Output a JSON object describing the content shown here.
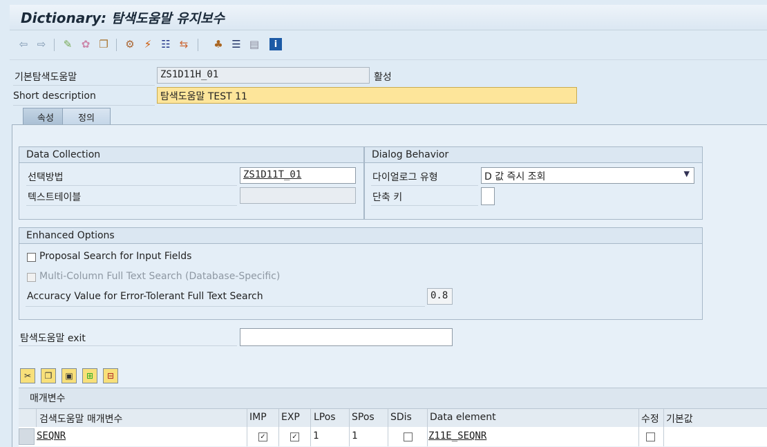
{
  "window": {
    "title": "Dictionary:",
    "title_sub": "탐색도움말 유지보수"
  },
  "toolbar": {
    "icons": [
      "back-arrow-icon",
      "forward-arrow-icon",
      "display-change-icon",
      "activate-icon",
      "other-object-icon",
      "check-icon",
      "where-used-icon",
      "object-list-icon",
      "navigate-icon",
      "hierarchy-icon",
      "documentation-icon",
      "info-icon"
    ]
  },
  "header": {
    "search_help_label": "기본탐색도움말",
    "search_help_value": "ZS1D11H_01",
    "status": "활성",
    "short_desc_label": "Short description",
    "short_desc_value": "탐색도움말 TEST 11"
  },
  "tabs": [
    "속성",
    "정의"
  ],
  "data_collection": {
    "title": "Data Collection",
    "selection_method_label": "선택방법",
    "selection_method_value": "ZS1D11T_01",
    "text_table_label": "텍스트테이블",
    "text_table_value": ""
  },
  "dialog_behavior": {
    "title": "Dialog Behavior",
    "dialog_type_label": "다이얼로그 유형",
    "dialog_type_value": "D 값 즉시 조회",
    "hotkey_label": "단축 키",
    "hotkey_value": ""
  },
  "enhanced": {
    "title": "Enhanced Options",
    "proposal_label": "Proposal Search for Input Fields",
    "multicolumn_label": "Multi-Column Full Text Search (Database-Specific)",
    "accuracy_label": "Accuracy Value for Error-Tolerant Full Text Search",
    "accuracy_value": "0.8"
  },
  "exit": {
    "label": "탐색도움말 exit",
    "value": ""
  },
  "params": {
    "section_label": "매개변수",
    "columns": [
      "검색도움말 매개변수",
      "IMP",
      "EXP",
      "LPos",
      "SPos",
      "SDis",
      "Data element",
      "수정",
      "기본값"
    ],
    "rows": [
      {
        "param": "SEQNR",
        "imp": true,
        "exp": true,
        "lpos": "1",
        "spos": "1",
        "sdis": false,
        "data_element": "Z11E_SEQNR",
        "modify": false,
        "default": ""
      }
    ]
  }
}
